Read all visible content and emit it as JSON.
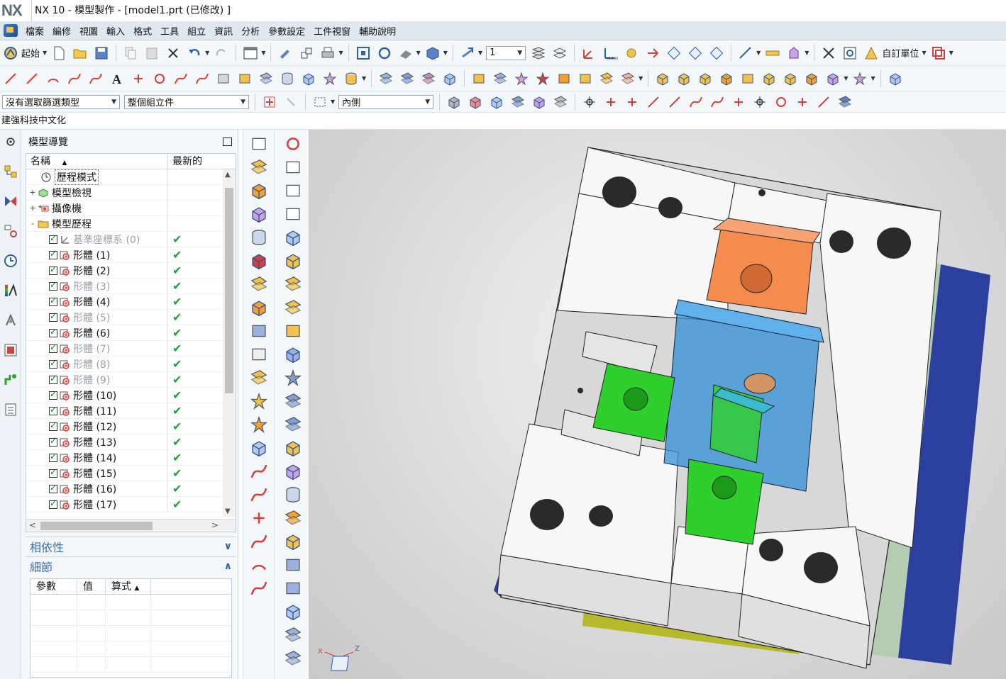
{
  "window": {
    "logo": "NX",
    "title": "NX 10 - 模型製作 - [model1.prt (已修改) ]"
  },
  "menubar": {
    "items": [
      "檔案",
      "編修",
      "視圖",
      "輸入",
      "格式",
      "工具",
      "組立",
      "資訊",
      "分析",
      "參數設定",
      "工件視窗",
      "輔助說明"
    ]
  },
  "toolbar1": {
    "start_label": "起始",
    "layer_value": "1",
    "custom_units_label": "自訂單位"
  },
  "toolbar3": {
    "filter_type": "沒有選取篩選類型",
    "scope": "整個組立件",
    "inside": "內側"
  },
  "breadcrumb": "建強科技中文化",
  "navigator": {
    "title": "模型導覽",
    "col_name": "名稱",
    "col_latest": "最新的",
    "rows": [
      {
        "label": "歷程模式",
        "kind": "history",
        "level": 0,
        "expander": "",
        "checkbox": false,
        "gray": false,
        "latest": false
      },
      {
        "label": "模型檢視",
        "kind": "view",
        "level": 0,
        "expander": "+",
        "checkbox": false,
        "gray": false,
        "latest": false
      },
      {
        "label": "攝像機",
        "kind": "camera",
        "level": 0,
        "expander": "+",
        "checkbox": false,
        "gray": false,
        "latest": false
      },
      {
        "label": "模型歷程",
        "kind": "folder",
        "level": 0,
        "expander": "-",
        "checkbox": false,
        "gray": false,
        "latest": false
      },
      {
        "label": "基準座標系 (0)",
        "kind": "csys",
        "level": 1,
        "expander": "",
        "checkbox": true,
        "gray": true,
        "latest": true
      },
      {
        "label": "形體 (1)",
        "kind": "body",
        "level": 1,
        "expander": "",
        "checkbox": true,
        "gray": false,
        "latest": true
      },
      {
        "label": "形體 (2)",
        "kind": "body",
        "level": 1,
        "expander": "",
        "checkbox": true,
        "gray": false,
        "latest": true
      },
      {
        "label": "形體 (3)",
        "kind": "body",
        "level": 1,
        "expander": "",
        "checkbox": true,
        "gray": true,
        "latest": true
      },
      {
        "label": "形體 (4)",
        "kind": "body",
        "level": 1,
        "expander": "",
        "checkbox": true,
        "gray": false,
        "latest": true
      },
      {
        "label": "形體 (5)",
        "kind": "body",
        "level": 1,
        "expander": "",
        "checkbox": true,
        "gray": true,
        "latest": true
      },
      {
        "label": "形體 (6)",
        "kind": "body",
        "level": 1,
        "expander": "",
        "checkbox": true,
        "gray": false,
        "latest": true
      },
      {
        "label": "形體 (7)",
        "kind": "body",
        "level": 1,
        "expander": "",
        "checkbox": true,
        "gray": true,
        "latest": true
      },
      {
        "label": "形體 (8)",
        "kind": "body",
        "level": 1,
        "expander": "",
        "checkbox": true,
        "gray": true,
        "latest": true
      },
      {
        "label": "形體 (9)",
        "kind": "body",
        "level": 1,
        "expander": "",
        "checkbox": true,
        "gray": true,
        "latest": true
      },
      {
        "label": "形體 (10)",
        "kind": "body",
        "level": 1,
        "expander": "",
        "checkbox": true,
        "gray": false,
        "latest": true
      },
      {
        "label": "形體 (11)",
        "kind": "body",
        "level": 1,
        "expander": "",
        "checkbox": true,
        "gray": false,
        "latest": true
      },
      {
        "label": "形體 (12)",
        "kind": "body",
        "level": 1,
        "expander": "",
        "checkbox": true,
        "gray": false,
        "latest": true
      },
      {
        "label": "形體 (13)",
        "kind": "body",
        "level": 1,
        "expander": "",
        "checkbox": true,
        "gray": false,
        "latest": true
      },
      {
        "label": "形體 (14)",
        "kind": "body",
        "level": 1,
        "expander": "",
        "checkbox": true,
        "gray": false,
        "latest": true
      },
      {
        "label": "形體 (15)",
        "kind": "body",
        "level": 1,
        "expander": "",
        "checkbox": true,
        "gray": false,
        "latest": true
      },
      {
        "label": "形體 (16)",
        "kind": "body",
        "level": 1,
        "expander": "",
        "checkbox": true,
        "gray": false,
        "latest": true
      },
      {
        "label": "形體 (17)",
        "kind": "body",
        "level": 1,
        "expander": "",
        "checkbox": true,
        "gray": false,
        "latest": true
      }
    ]
  },
  "dependencies": {
    "title": "相依性"
  },
  "details": {
    "title": "細節",
    "col_param": "參數",
    "col_value": "值",
    "col_expr": "算式"
  },
  "colors": {
    "accent": "#3d6fa8",
    "menubar_bg": "#dfe8f0",
    "plate_white": "#f7f7f7",
    "orange_block": "#f58b4c",
    "blue_block": "#2f8fd6",
    "green_block": "#2ed12b",
    "side_green": "#b4ccb0",
    "side_blue": "#2a3f9e",
    "yellow_plate": "#b7b92a"
  },
  "triad": {
    "x": "X",
    "z": "Z"
  }
}
